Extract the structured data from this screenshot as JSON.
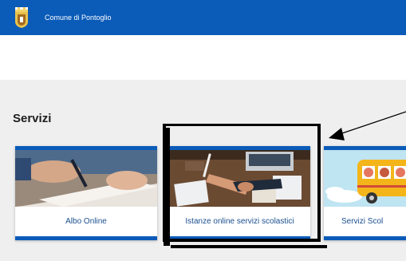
{
  "header": {
    "site_name": "Comune di Pontoglio",
    "logo_icon": "coat-of-arms-icon",
    "bg_color": "#0b5bb8"
  },
  "services": {
    "title": "Servizi",
    "cards": [
      {
        "label": "Albo Online",
        "image_icon": "signing-document-photo"
      },
      {
        "label": "Istanze online servizi scolastici",
        "image_icon": "handshake-desk-photo"
      },
      {
        "label": "Servizi Scol",
        "image_icon": "school-bus-children-photo"
      }
    ]
  },
  "annotation": {
    "arrow_icon": "pointer-arrow-icon",
    "highlight_color": "#000000"
  }
}
